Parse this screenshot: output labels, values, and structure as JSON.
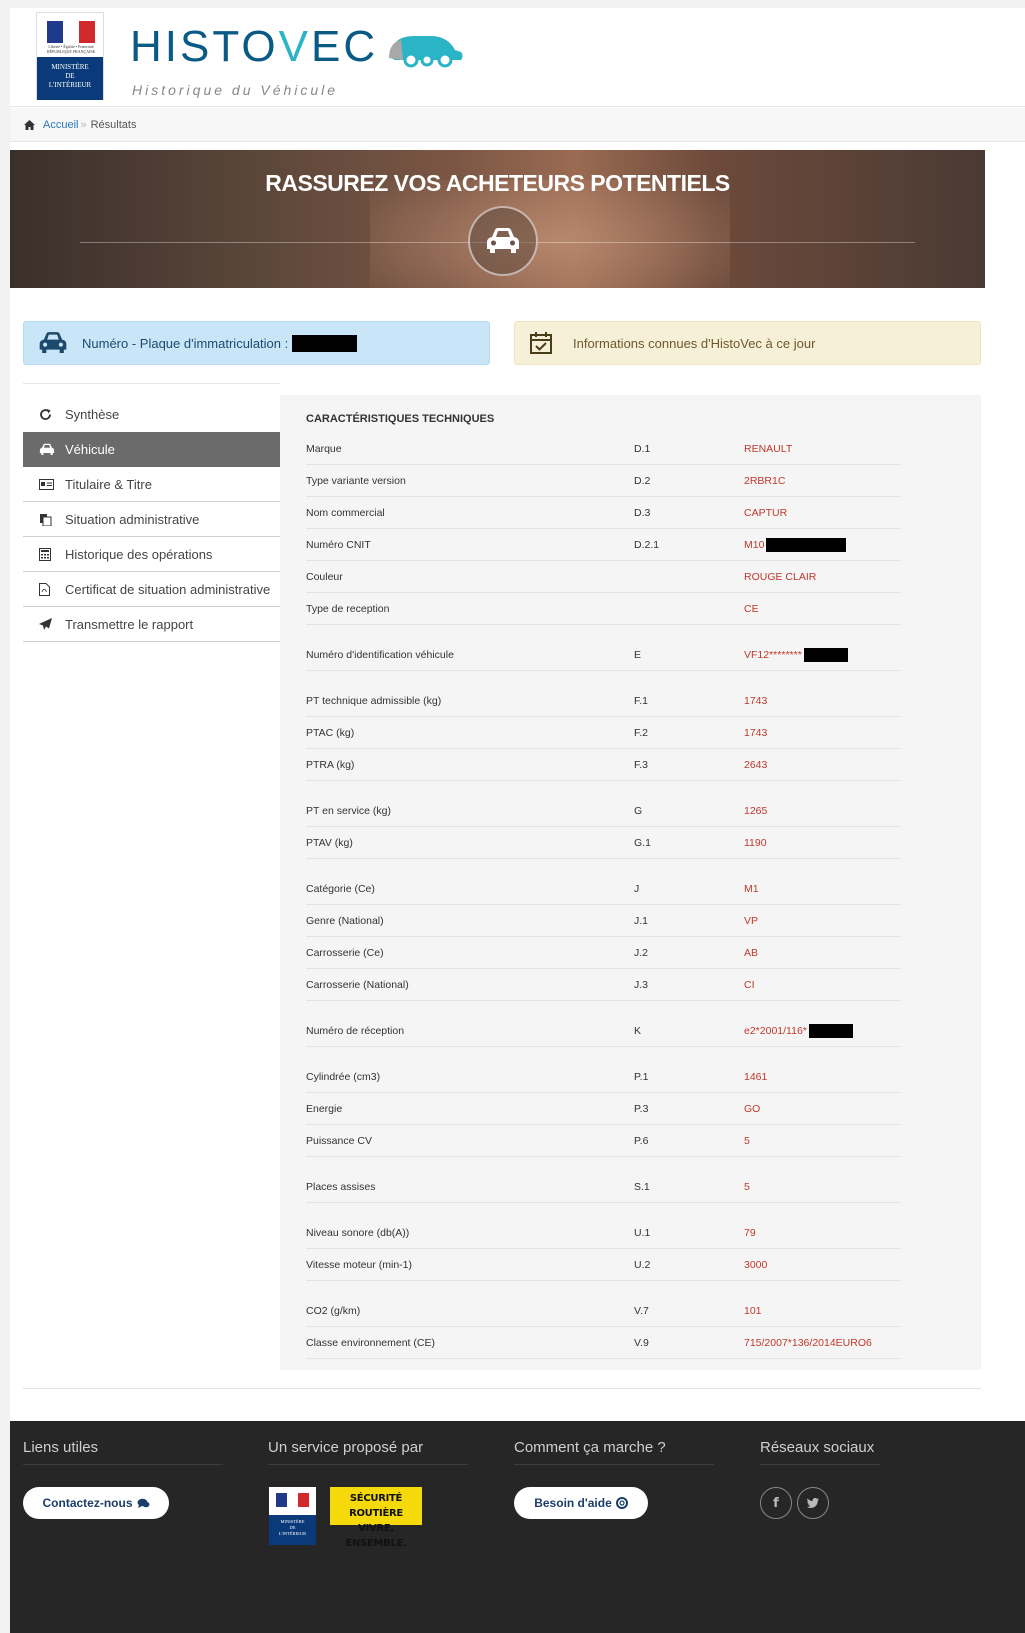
{
  "header": {
    "logo_ministry_lines": [
      "MINISTÈRE",
      "DE",
      "L'INTÉRIEUR"
    ],
    "logo_republic": "Liberté • Égalité • Fraternité RÉPUBLIQUE FRANÇAISE",
    "brand_prefix": "HISTO",
    "brand_v": "V",
    "brand_suffix": "EC",
    "brand_subtitle": "Historique du Véhicule"
  },
  "breadcrumb": {
    "home": "Accueil",
    "separator": "»",
    "current": "Résultats"
  },
  "hero": {
    "title": "RASSUREZ VOS ACHETEURS POTENTIELS"
  },
  "banners": {
    "plate_label": "Numéro - Plaque d'immatriculation :",
    "info_label": "Informations connues d'HistoVec à ce jour"
  },
  "nav": [
    {
      "label": "Synthèse",
      "icon": "refresh-icon"
    },
    {
      "label": "Véhicule",
      "icon": "car-icon",
      "active": true
    },
    {
      "label": "Titulaire & Titre",
      "icon": "id-card-icon"
    },
    {
      "label": "Situation administrative",
      "icon": "copy-icon"
    },
    {
      "label": "Historique des opérations",
      "icon": "calculator-icon"
    },
    {
      "label": "Certificat de situation administrative",
      "icon": "pdf-file-icon"
    },
    {
      "label": "Transmettre le rapport",
      "icon": "paper-plane-icon"
    }
  ],
  "content": {
    "title": "CARACTÉRISTIQUES TECHNIQUES",
    "rows": [
      {
        "label": "Marque",
        "code": "D.1",
        "value": "RENAULT"
      },
      {
        "label": "Type variante version",
        "code": "D.2",
        "value": "2RBR1C"
      },
      {
        "label": "Nom commercial",
        "code": "D.3",
        "value": "CAPTUR"
      },
      {
        "label": "Numéro CNIT",
        "code": "D.2.1",
        "value": "M10",
        "redacted": true
      },
      {
        "label": "Couleur",
        "code": "",
        "value": "ROUGE CLAIR"
      },
      {
        "label": "Type de reception",
        "code": "",
        "value": "CE"
      },
      {
        "label": "Numéro d'identification véhicule",
        "code": "E",
        "value": "VF12********",
        "redacted": true,
        "gap": true
      },
      {
        "label": "PT technique admissible (kg)",
        "code": "F.1",
        "value": "1743",
        "gap": true
      },
      {
        "label": "PTAC (kg)",
        "code": "F.2",
        "value": "1743"
      },
      {
        "label": "PTRA (kg)",
        "code": "F.3",
        "value": "2643"
      },
      {
        "label": "PT en service (kg)",
        "code": "G",
        "value": "1265",
        "gap": true
      },
      {
        "label": "PTAV (kg)",
        "code": "G.1",
        "value": "1190"
      },
      {
        "label": "Catégorie (Ce)",
        "code": "J",
        "value": "M1",
        "gap": true
      },
      {
        "label": "Genre (National)",
        "code": "J.1",
        "value": "VP"
      },
      {
        "label": "Carrosserie (Ce)",
        "code": "J.2",
        "value": "AB"
      },
      {
        "label": "Carrosserie (National)",
        "code": "J.3",
        "value": "CI"
      },
      {
        "label": "Numéro de réception",
        "code": "K",
        "value": "e2*2001/116*",
        "redacted": true,
        "gap": true
      },
      {
        "label": "Cylindrée (cm3)",
        "code": "P.1",
        "value": "1461",
        "gap": true
      },
      {
        "label": "Energie",
        "code": "P.3",
        "value": "GO"
      },
      {
        "label": "Puissance CV",
        "code": "P.6",
        "value": "5"
      },
      {
        "label": "Places assises",
        "code": "S.1",
        "value": "5",
        "gap": true
      },
      {
        "label": "Niveau sonore (db(A))",
        "code": "U.1",
        "value": "79",
        "gap": true
      },
      {
        "label": "Vitesse moteur (min-1)",
        "code": "U.2",
        "value": "3000"
      },
      {
        "label": "CO2 (g/km)",
        "code": "V.7",
        "value": "101",
        "gap": true
      },
      {
        "label": "Classe environnement (CE)",
        "code": "V.9",
        "value": "715/2007*136/2014EURO6"
      }
    ]
  },
  "footer": {
    "col1_title": "Liens utiles",
    "contact_label": "Contactez-nous",
    "col2_title": "Un service proposé par",
    "securite_line1": "SÉCURITÉ ROUTIÈRE",
    "securite_line2": "VIVRE, ENSEMBLE.",
    "col3_title": "Comment ça marche ?",
    "help_label": "Besoin d'aide",
    "col4_title": "Réseaux sociaux",
    "social": [
      "facebook-icon",
      "twitter-icon"
    ]
  },
  "colors": {
    "value_red": "#c0392b",
    "brand_blue": "#0a5a86",
    "brand_teal": "#2bb3c6",
    "nav_active": "#6b6b6b",
    "footer_bg": "#262626"
  }
}
